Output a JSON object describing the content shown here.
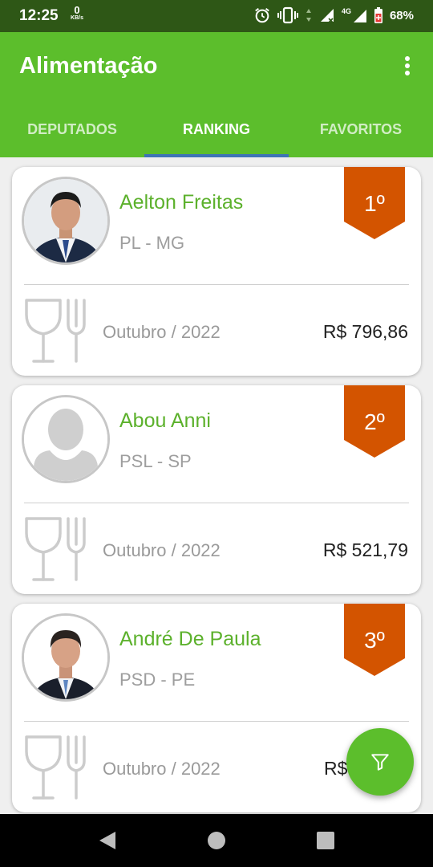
{
  "status_bar": {
    "time": "12:25",
    "net_speed": "0",
    "net_speed_unit": "KB/s",
    "network_type": "4G",
    "battery": "68%",
    "icons": [
      "alarm-icon",
      "vibrate-icon",
      "signal-icon",
      "battery-icon"
    ]
  },
  "app_bar": {
    "title": "Alimentação",
    "menu_icon": "more-vert-icon"
  },
  "tabs": [
    {
      "label": "DEPUTADOS",
      "active": false
    },
    {
      "label": "RANKING",
      "active": true
    },
    {
      "label": "FAVORITOS",
      "active": false
    }
  ],
  "cards": [
    {
      "name": "Aelton Freitas",
      "party": "PL - MG",
      "rank": "1º",
      "month": "Outubro / 2022",
      "amount": "R$ 796,86",
      "photo": "photo"
    },
    {
      "name": "Abou Anni",
      "party": "PSL - SP",
      "rank": "2º",
      "month": "Outubro / 2022",
      "amount": "R$ 521,79",
      "photo": "placeholder"
    },
    {
      "name": "André De Paula",
      "party": "PSD - PE",
      "rank": "3º",
      "month": "Outubro / 2022",
      "amount": "R$ 4",
      "photo": "photo"
    }
  ],
  "fab": {
    "icon": "filter-icon"
  },
  "colors": {
    "primary": "#5cbe2c",
    "status_bar": "#2e5716",
    "name_text": "#5cb12c",
    "rank_badge": "#d35400",
    "tab_indicator": "#3e74b6"
  },
  "nav_bar": {
    "icons": [
      "back-icon",
      "home-icon",
      "recents-icon"
    ]
  }
}
